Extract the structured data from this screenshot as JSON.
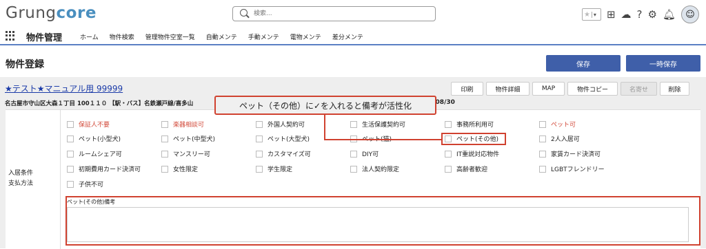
{
  "header": {
    "logo_main": "Grung",
    "logo_accent": "core",
    "search_placeholder": "検索...",
    "star_icon": "star-icon",
    "add_icon": "plus-square-icon",
    "cloud_icon": "cloud-icon",
    "help_label": "?",
    "settings_icon": "gear-icon",
    "bell_icon": "bell-icon"
  },
  "nav": {
    "title": "物件管理",
    "items": [
      "ホーム",
      "物件検索",
      "管理物件空室一覧",
      "自動メンテ",
      "手動メンテ",
      "電物メンテ",
      "差分メンテ"
    ]
  },
  "page": {
    "title": "物件登録",
    "save_label": "保存",
    "temp_save_label": "一時保存"
  },
  "record": {
    "name": "★テスト★マニュアル用 99999",
    "address": "名古屋市守山区大森１丁目 100１１０ 【駅・バス】名鉄瀬戸線/喜多山",
    "date_fragment": "4/08/30",
    "actions": [
      "印刷",
      "物件詳細",
      "MAP",
      "物件コピー",
      "名寄せ",
      "削除"
    ]
  },
  "section": {
    "label_line1": "入居条件",
    "label_line2": "支払方法",
    "checkboxes": [
      {
        "label": "保証人不要",
        "red": true
      },
      {
        "label": "楽器相談可",
        "red": true
      },
      {
        "label": "外国人契約可",
        "red": false
      },
      {
        "label": "生活保護契約可",
        "red": false
      },
      {
        "label": "事務所利用可",
        "red": false
      },
      {
        "label": "ペット可",
        "red": true
      },
      {
        "label": "ペット(小型犬)",
        "red": false
      },
      {
        "label": "ペット(中型犬)",
        "red": false
      },
      {
        "label": "ペット(大型犬)",
        "red": false
      },
      {
        "label": "ペット(猫)",
        "red": false
      },
      {
        "label": "ペット(その他)",
        "red": false
      },
      {
        "label": "2人入居可",
        "red": false
      },
      {
        "label": "ルームシェア可",
        "red": false
      },
      {
        "label": "マンスリー可",
        "red": false
      },
      {
        "label": "カスタマイズ可",
        "red": false
      },
      {
        "label": "DIY可",
        "red": false
      },
      {
        "label": "IT重説対応物件",
        "red": false
      },
      {
        "label": "家賃カード決済可",
        "red": false
      },
      {
        "label": "初期費用カード決済可",
        "red": false
      },
      {
        "label": "女性限定",
        "red": false
      },
      {
        "label": "学生限定",
        "red": false
      },
      {
        "label": "法人契約限定",
        "red": false
      },
      {
        "label": "高齢者歓迎",
        "red": false
      },
      {
        "label": "LGBTフレンドリー",
        "red": false
      },
      {
        "label": "子供不可",
        "red": false
      }
    ],
    "remark_label": "ペット(その他)備考",
    "remark_value": ""
  },
  "annotation": {
    "callout_text": "ペット（その他）に✓を入れると備考が活性化",
    "accent_color": "#d0412f"
  }
}
